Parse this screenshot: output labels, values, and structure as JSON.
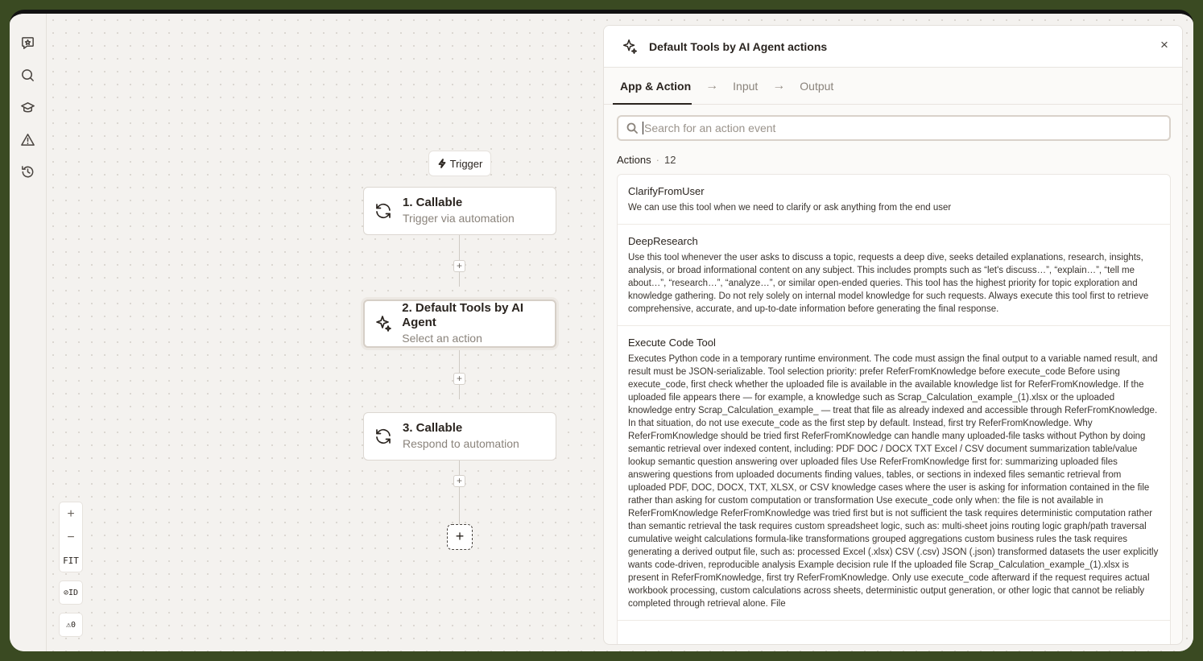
{
  "sidebar": {
    "icons": [
      "chat-star-icon",
      "search-icon",
      "graduation-cap-icon",
      "warning-icon",
      "history-icon"
    ]
  },
  "canvas": {
    "trigger_label": "Trigger",
    "nodes": [
      {
        "title": "1. Callable",
        "subtitle": "Trigger via automation",
        "icon": "refresh-icon"
      },
      {
        "title": "2. Default Tools by AI Agent",
        "subtitle": "Select an action",
        "icon": "sparkle-icon"
      },
      {
        "title": "3. Callable",
        "subtitle": "Respond to automation",
        "icon": "refresh-icon"
      }
    ],
    "add_label": "+",
    "zoom": {
      "in": "+",
      "out": "−",
      "fit": "FIT"
    },
    "id_toggle": "⊘ID",
    "warnings": "⚠0"
  },
  "panel": {
    "title": "Default Tools by AI Agent actions",
    "close": "×",
    "tabs": [
      {
        "label": "App & Action",
        "active": true
      },
      {
        "label": "Input",
        "active": false
      },
      {
        "label": "Output",
        "active": false
      }
    ],
    "tab_arrow": "→",
    "search": {
      "placeholder": "Search for an action event",
      "value": ""
    },
    "actions_label": "Actions",
    "actions_dot": "·",
    "actions_count": "12",
    "actions": [
      {
        "title": "ClarifyFromUser",
        "description": "We can use this tool when we need to clarify or ask anything from the end user"
      },
      {
        "title": "DeepResearch",
        "description": "Use this tool whenever the user asks to discuss a topic, requests a deep dive, seeks detailed explanations, research, insights, analysis, or broad informational content on any subject. This includes prompts such as “let's discuss…”, “explain…”, “tell me about…”, “research…”, “analyze…”, or similar open-ended queries. This tool has the highest priority for topic exploration and knowledge gathering. Do not rely solely on internal model knowledge for such requests. Always execute this tool first to retrieve comprehensive, accurate, and up-to-date information before generating the final response."
      },
      {
        "title": "Execute Code Tool",
        "description": "Executes Python code in a temporary runtime environment. The code must assign the final output to a variable named result, and result must be JSON-serializable. Tool selection priority: prefer ReferFromKnowledge before execute_code Before using execute_code, first check whether the uploaded file is available in the available knowledge list for ReferFromKnowledge. If the uploaded file appears there — for example, a knowledge such as Scrap_Calculation_example_(1).xlsx or the uploaded knowledge entry Scrap_Calculation_example_ — treat that file as already indexed and accessible through ReferFromKnowledge. In that situation, do not use execute_code as the first step by default. Instead, first try ReferFromKnowledge. Why ReferFromKnowledge should be tried first ReferFromKnowledge can handle many uploaded-file tasks without Python by doing semantic retrieval over indexed content, including: PDF DOC / DOCX TXT Excel / CSV document summarization table/value lookup semantic question answering over uploaded files Use ReferFromKnowledge first for: summarizing uploaded files answering questions from uploaded documents finding values, tables, or sections in indexed files semantic retrieval from uploaded PDF, DOC, DOCX, TXT, XLSX, or CSV knowledge cases where the user is asking for information contained in the file rather than asking for custom computation or transformation Use execute_code only when: the file is not available in ReferFromKnowledge ReferFromKnowledge was tried first but is not sufficient the task requires deterministic computation rather than semantic retrieval the task requires custom spreadsheet logic, such as: multi-sheet joins routing logic graph/path traversal cumulative weight calculations formula-like transformations grouped aggregations custom business rules the task requires generating a derived output file, such as: processed Excel (.xlsx) CSV (.csv) JSON (.json) transformed datasets the user explicitly wants code-driven, reproducible analysis Example decision rule If the uploaded file Scrap_Calculation_example_(1).xlsx is present in ReferFromKnowledge, first try ReferFromKnowledge. Only use execute_code afterward if the request requires actual workbook processing, custom calculations across sheets, deterministic output generation, or other logic that cannot be reliably completed through retrieval alone. File"
      }
    ]
  }
}
